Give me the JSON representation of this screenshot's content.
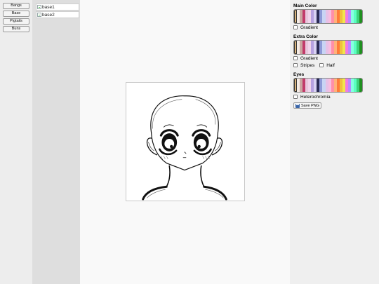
{
  "categories": [
    {
      "label": "Bangs"
    },
    {
      "label": "Base"
    },
    {
      "label": "Pigtails"
    },
    {
      "label": "Buns"
    }
  ],
  "parts": [
    {
      "alt": "base1"
    },
    {
      "alt": "base2"
    }
  ],
  "sections": {
    "main_color": {
      "title": "Main Color",
      "gradient_label": "Gradient"
    },
    "extra_color": {
      "title": "Extra Color",
      "gradient_label": "Gradient",
      "stripes_label": "Stripes",
      "half_label": "Half"
    },
    "eyes": {
      "title": "Eyes",
      "heterochromia_label": "Heterochromia"
    }
  },
  "save_button": {
    "label": "Save PNG",
    "icon": "floppy-disk-icon"
  },
  "palette": [
    "#d9b27a",
    "#f5ece5",
    "#c9a6a0",
    "#c23b6a",
    "#e8c6dc",
    "#f0d4ea",
    "#b7a2e0",
    "#d8d2f2",
    "#2b2b55",
    "#8e9ad8",
    "#c8d4f4",
    "#e6c0e6",
    "#f7bde0",
    "#ff8fa8",
    "#ffb27a",
    "#ff7a3a",
    "#f0c03c",
    "#f0e64c",
    "#f27ae0",
    "#b888ff",
    "#86ffe0",
    "#5affc0",
    "#3cd07a",
    "#1f8f1f"
  ]
}
